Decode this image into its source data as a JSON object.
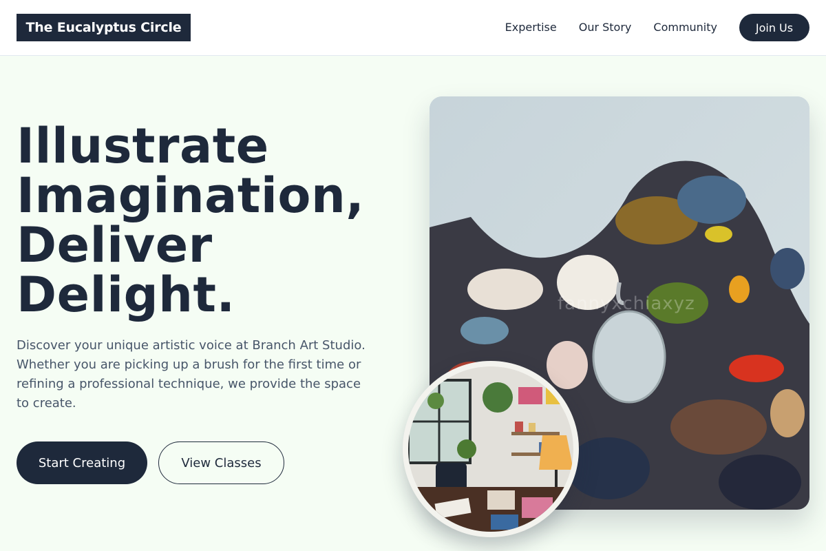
{
  "header": {
    "logo": "The Eucalyptus Circle",
    "nav": [
      "Expertise",
      "Our Story",
      "Community"
    ],
    "cta": "Join Us"
  },
  "hero": {
    "headline": [
      "Illustrate",
      "Imagination,",
      "Deliver",
      "Delight."
    ],
    "subtext": "Discover your unique artistic voice at Branch Art Studio. Whether you are picking up a brush for the first time or refining a professional technique, we provide the space to create.",
    "primary_button": "Start Creating",
    "secondary_button": "View Classes"
  },
  "images": {
    "main": "paint-palette-photo",
    "main_watermark": "fannyxchiaxyz",
    "inset": "art-studio-interior-photo"
  },
  "colors": {
    "navy": "#1e293b",
    "background": "#f5fdf4",
    "body_text": "#475569"
  }
}
